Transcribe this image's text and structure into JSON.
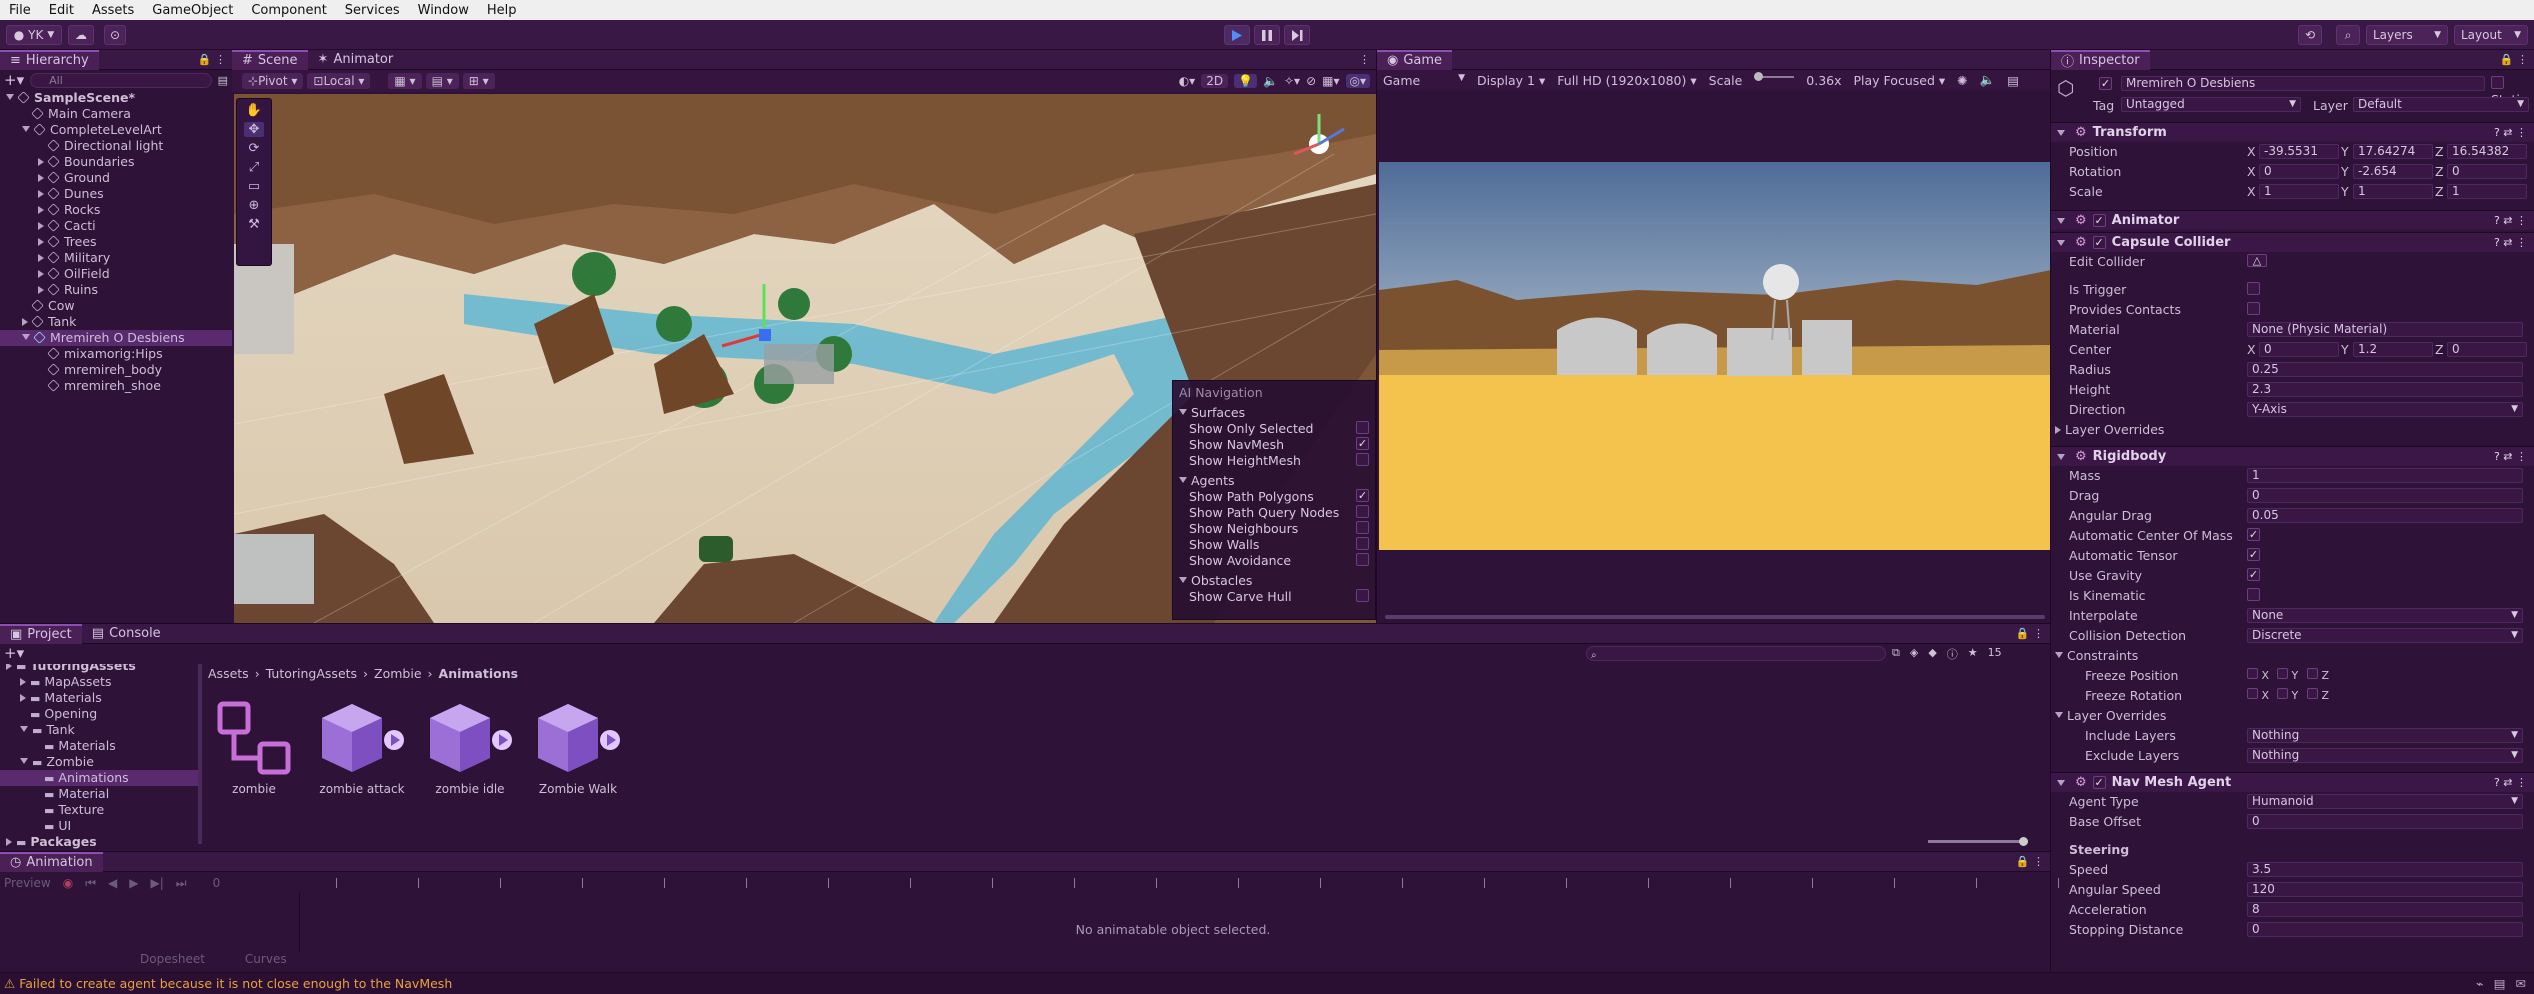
{
  "menu": [
    "File",
    "Edit",
    "Assets",
    "GameObject",
    "Component",
    "Services",
    "Window",
    "Help"
  ],
  "toolbar": {
    "account": "YK",
    "layers": "Layers",
    "layout": "Layout"
  },
  "hierarchy": {
    "tab": "Hierarchy",
    "search_placeholder": "All",
    "items": [
      {
        "label": "SampleScene*",
        "depth": 0,
        "bold": true
      },
      {
        "label": "Main Camera",
        "depth": 1
      },
      {
        "label": "CompleteLevelArt",
        "depth": 1
      },
      {
        "label": "Directional light",
        "depth": 2
      },
      {
        "label": "Boundaries",
        "depth": 2
      },
      {
        "label": "Ground",
        "depth": 2
      },
      {
        "label": "Dunes",
        "depth": 2
      },
      {
        "label": "Rocks",
        "depth": 2
      },
      {
        "label": "Cacti",
        "depth": 2
      },
      {
        "label": "Trees",
        "depth": 2
      },
      {
        "label": "Military",
        "depth": 2
      },
      {
        "label": "OilField",
        "depth": 2
      },
      {
        "label": "Ruins",
        "depth": 2
      },
      {
        "label": "Cow",
        "depth": 1
      },
      {
        "label": "Tank",
        "depth": 1
      },
      {
        "label": "Mremireh O Desbiens",
        "depth": 1,
        "selected": true
      },
      {
        "label": "mixamorig:Hips",
        "depth": 2
      },
      {
        "label": "mremireh_body",
        "depth": 2
      },
      {
        "label": "mremireh_shoe",
        "depth": 2
      }
    ]
  },
  "scene": {
    "tab": "Scene",
    "tab2": "Animator",
    "pivot": "Pivot",
    "local": "Local",
    "mode2d": "2D"
  },
  "ai_nav": {
    "title": "AI Navigation",
    "sections": [
      {
        "name": "Surfaces",
        "items": [
          {
            "label": "Show Only Selected",
            "checked": false
          },
          {
            "label": "Show NavMesh",
            "checked": true
          },
          {
            "label": "Show HeightMesh",
            "checked": false
          }
        ]
      },
      {
        "name": "Agents",
        "items": [
          {
            "label": "Show Path Polygons",
            "checked": true
          },
          {
            "label": "Show Path Query Nodes",
            "checked": false
          },
          {
            "label": "Show Neighbours",
            "checked": false
          },
          {
            "label": "Show Walls",
            "checked": false
          },
          {
            "label": "Show Avoidance",
            "checked": false
          }
        ]
      },
      {
        "name": "Obstacles",
        "items": [
          {
            "label": "Show Carve Hull",
            "checked": false
          }
        ]
      }
    ]
  },
  "game": {
    "tab": "Game",
    "mode": "Game",
    "display": "Display 1",
    "resolution": "Full HD (1920x1080)",
    "scale_label": "Scale",
    "scale_value": "0.36x",
    "play_focused": "Play Focused"
  },
  "inspector": {
    "tab": "Inspector",
    "object_name": "Mremireh O Desbiens",
    "static_label": "Static",
    "tag_label": "Tag",
    "tag_value": "Untagged",
    "layer_label": "Layer",
    "layer_value": "Default",
    "transform": {
      "title": "Transform",
      "position_label": "Position",
      "rotation_label": "Rotation",
      "scale_label": "Scale",
      "position": [
        "-39.5531",
        "17.64274",
        "16.54382"
      ],
      "rotation": [
        "0",
        "-2.654",
        "0"
      ],
      "scale": [
        "1",
        "1",
        "1"
      ]
    },
    "animator_title": "Animator",
    "capsule": {
      "title": "Capsule Collider",
      "edit_collider": "Edit Collider",
      "is_trigger": "Is Trigger",
      "provides_contacts": "Provides Contacts",
      "material_label": "Material",
      "material_value": "None (Physic Material)",
      "center_label": "Center",
      "center": [
        "0",
        "1.2",
        "0"
      ],
      "radius_label": "Radius",
      "radius": "0.25",
      "height_label": "Height",
      "height": "2.3",
      "direction_label": "Direction",
      "direction": "Y-Axis",
      "layer_overrides": "Layer Overrides"
    },
    "rigidbody": {
      "title": "Rigidbody",
      "mass_label": "Mass",
      "mass": "1",
      "drag_label": "Drag",
      "drag": "0",
      "angular_drag_label": "Angular Drag",
      "angular_drag": "0.05",
      "auto_com": "Automatic Center Of Mass",
      "auto_tensor": "Automatic Tensor",
      "use_gravity": "Use Gravity",
      "is_kinematic": "Is Kinematic",
      "interpolate_label": "Interpolate",
      "interpolate": "None",
      "collision_label": "Collision Detection",
      "collision": "Discrete",
      "constraints": "Constraints",
      "freeze_position": "Freeze Position",
      "freeze_rotation": "Freeze Rotation",
      "layer_overrides": "Layer Overrides",
      "include_layers": "Include Layers",
      "include_value": "Nothing",
      "exclude_layers": "Exclude Layers",
      "exclude_value": "Nothing"
    },
    "navmesh": {
      "title": "Nav Mesh Agent",
      "agent_type_label": "Agent Type",
      "agent_type": "Humanoid",
      "base_offset_label": "Base Offset",
      "base_offset": "0",
      "steering": "Steering",
      "speed_label": "Speed",
      "speed": "3.5",
      "angular_speed_label": "Angular Speed",
      "angular_speed": "120",
      "acceleration_label": "Acceleration",
      "acceleration": "8",
      "stopping_label": "Stopping Distance",
      "stopping": "0"
    }
  },
  "project": {
    "tab": "Project",
    "tab2": "Console",
    "tree": [
      {
        "label": "TutoringAssets",
        "depth": 0
      },
      {
        "label": "MapAssets",
        "depth": 1
      },
      {
        "label": "Materials",
        "depth": 1
      },
      {
        "label": "Opening",
        "depth": 1
      },
      {
        "label": "Tank",
        "depth": 1
      },
      {
        "label": "Materials",
        "depth": 2
      },
      {
        "label": "Zombie",
        "depth": 1
      },
      {
        "label": "Animations",
        "depth": 2,
        "selected": true
      },
      {
        "label": "Material",
        "depth": 2
      },
      {
        "label": "Texture",
        "depth": 2
      },
      {
        "label": "UI",
        "depth": 2
      },
      {
        "label": "Packages",
        "depth": 0
      }
    ],
    "breadcrumb": [
      "Assets",
      "TutoringAssets",
      "Zombie",
      "Animations"
    ],
    "assets": [
      {
        "label": "zombie",
        "kind": "controller"
      },
      {
        "label": "zombie attack",
        "kind": "clip"
      },
      {
        "label": "zombie idle",
        "kind": "clip"
      },
      {
        "label": "Zombie Walk",
        "kind": "clip"
      }
    ],
    "count": "15"
  },
  "animation": {
    "tab": "Animation",
    "preview": "Preview",
    "frame": "0",
    "empty": "No animatable object selected.",
    "dopesheet": "Dopesheet",
    "curves": "Curves"
  },
  "status": {
    "message": "Failed to create agent because it is not close enough to the NavMesh"
  },
  "colors": {
    "accent": "#4f8ff7",
    "warning": "#e8a23a",
    "navmesh": "#4fb3d6"
  }
}
